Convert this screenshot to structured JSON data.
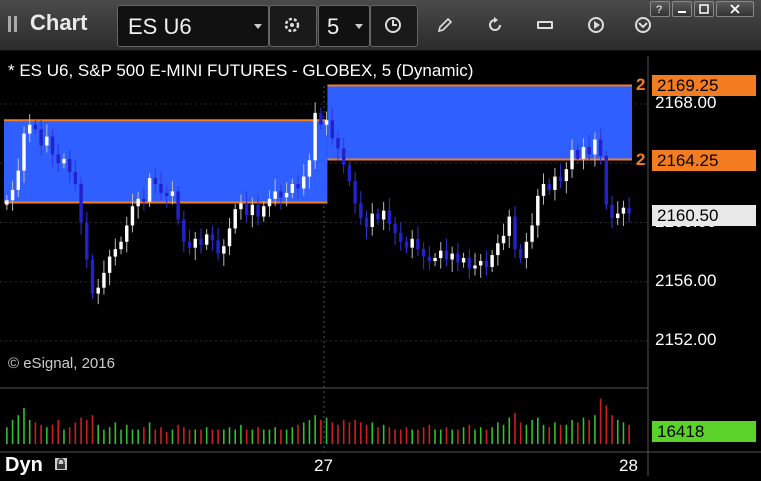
{
  "toolbar": {
    "app_title": "Chart",
    "symbol": "ES U6",
    "interval": "5"
  },
  "chart_header": "* ES U6, S&P 500 E-MINI FUTURES - GLOBEX, 5 (Dynamic)",
  "copyright": "© eSignal, 2016",
  "bottom_left": "Dyn",
  "colors": {
    "zone_fill": "#2f5fff",
    "zone_line": "#f47c20",
    "up_candle": "#ffffff",
    "down_candle": "#2222cc",
    "volume_up": "#30c030",
    "volume_down": "#cc2020",
    "volume_tag": "#5ad22a",
    "last_price_tag": "#e8e8e8"
  },
  "chart_data": {
    "type": "candlestick",
    "title": "* ES U6, S&P 500 E-MINI FUTURES - GLOBEX, 5 (Dynamic)",
    "y_axis": {
      "ticks": [
        "2168.00",
        "2164.00",
        "2160.00",
        "2156.00",
        "2152.00"
      ],
      "tick_values": [
        2168.0,
        2164.0,
        2160.0,
        2156.0,
        2152.0
      ],
      "range": [
        2149.5,
        2170.5
      ]
    },
    "x_axis": {
      "labels": [
        "27",
        "28"
      ]
    },
    "price_tags": [
      {
        "label": "2169.25",
        "value": 2169.25,
        "count": "2"
      },
      {
        "label": "2164.25",
        "value": 2164.25,
        "count": "2"
      }
    ],
    "last_price": {
      "label": "2160.50",
      "value": 2160.5
    },
    "zones": [
      {
        "top": 2166.9,
        "bottom": 2161.35,
        "start": 0.0,
        "end": 0.515
      },
      {
        "top": 2169.25,
        "bottom": 2164.25,
        "start": 0.515,
        "end": 1.0
      }
    ],
    "volume_last": "16418",
    "closes": [
      2161.5,
      2162.2,
      2163.5,
      2166.0,
      2166.6,
      2166.3,
      2165.2,
      2165.8,
      2164.6,
      2164.0,
      2164.3,
      2163.4,
      2162.6,
      2160.0,
      2157.5,
      2155.2,
      2155.6,
      2156.6,
      2157.7,
      2158.2,
      2158.7,
      2159.8,
      2161.1,
      2161.6,
      2161.4,
      2163.0,
      2162.6,
      2162.0,
      2161.8,
      2162.1,
      2160.2,
      2158.7,
      2158.3,
      2158.9,
      2158.5,
      2159.2,
      2158.8,
      2157.9,
      2158.4,
      2159.6,
      2160.9,
      2161.3,
      2160.5,
      2161.2,
      2160.4,
      2161.1,
      2161.6,
      2162.1,
      2161.7,
      2162.0,
      2162.6,
      2162.3,
      2163.1,
      2164.2,
      2167.4,
      2166.6,
      2166.9,
      2165.7,
      2165.0,
      2163.9,
      2162.8,
      2161.3,
      2160.3,
      2159.7,
      2160.6,
      2160.2,
      2160.8,
      2159.9,
      2159.3,
      2158.7,
      2158.3,
      2158.9,
      2158.2,
      2157.7,
      2157.4,
      2157.6,
      2158.1,
      2157.5,
      2157.9,
      2157.3,
      2157.6,
      2156.9,
      2157.1,
      2157.4,
      2157.0,
      2157.8,
      2158.6,
      2159.1,
      2160.4,
      2158.2,
      2157.6,
      2158.7,
      2159.8,
      2161.8,
      2162.6,
      2162.2,
      2163.1,
      2162.8,
      2163.6,
      2164.9,
      2164.3,
      2165.1,
      2164.6,
      2165.6,
      2164.5,
      2161.2,
      2160.3,
      2160.6,
      2161.0,
      2160.6
    ],
    "volumes": [
      0.35,
      0.5,
      0.6,
      0.75,
      0.5,
      0.45,
      0.4,
      0.35,
      0.4,
      0.5,
      0.3,
      0.35,
      0.45,
      0.55,
      0.5,
      0.6,
      0.4,
      0.3,
      0.35,
      0.45,
      0.3,
      0.4,
      0.3,
      0.3,
      0.35,
      0.45,
      0.3,
      0.35,
      0.25,
      0.3,
      0.4,
      0.35,
      0.3,
      0.3,
      0.3,
      0.35,
      0.3,
      0.3,
      0.3,
      0.35,
      0.3,
      0.4,
      0.3,
      0.3,
      0.35,
      0.3,
      0.3,
      0.35,
      0.3,
      0.3,
      0.35,
      0.4,
      0.45,
      0.5,
      0.6,
      0.5,
      0.55,
      0.45,
      0.4,
      0.5,
      0.45,
      0.5,
      0.45,
      0.4,
      0.45,
      0.35,
      0.4,
      0.35,
      0.3,
      0.3,
      0.35,
      0.3,
      0.3,
      0.35,
      0.4,
      0.3,
      0.3,
      0.35,
      0.3,
      0.3,
      0.35,
      0.4,
      0.3,
      0.35,
      0.3,
      0.35,
      0.45,
      0.4,
      0.55,
      0.65,
      0.45,
      0.4,
      0.5,
      0.55,
      0.4,
      0.35,
      0.45,
      0.4,
      0.4,
      0.5,
      0.45,
      0.55,
      0.5,
      0.6,
      0.95,
      0.8,
      0.6,
      0.5,
      0.45,
      0.4
    ]
  }
}
